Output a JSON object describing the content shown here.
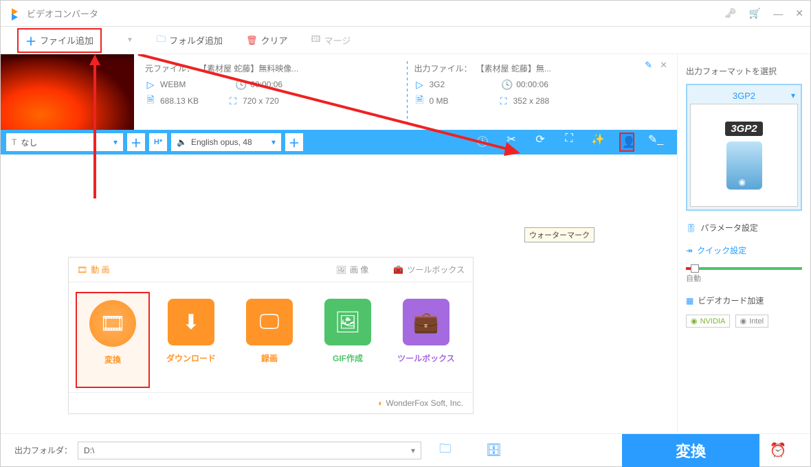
{
  "titlebar": {
    "app_name": "ビデオコンバータ"
  },
  "toolbar": {
    "add_file": "ファイル追加",
    "add_folder": "フォルダ追加",
    "clear": "クリア",
    "merge": "マージ"
  },
  "file": {
    "source_label": "元ファイル：",
    "source_name": "【素材屋 蛇藤】無料映像...",
    "src_format": "WEBM",
    "src_duration": "00:00:06",
    "src_size": "688.13 KB",
    "src_res": "720 x 720",
    "output_label": "出力ファイル：",
    "output_name": "【素材屋 蛇藤】無...",
    "out_format": "3G2",
    "out_duration": "00:00:06",
    "out_size": "0 MB",
    "out_res": "352 x 288"
  },
  "actionbar": {
    "subtitle_none": "なし",
    "audio_track": "English opus, 48"
  },
  "tooltip": {
    "watermark": "ウォーターマーク"
  },
  "category": {
    "tab_video": "動 画",
    "tab_image": "画 像",
    "tab_toolbox": "ツールボックス",
    "card_convert": "変換",
    "card_download": "ダウンロード",
    "card_record": "録画",
    "card_gif": "GIF作成",
    "card_toolbox": "ツールボックス",
    "brand": "WonderFox Soft, Inc."
  },
  "right": {
    "title": "出力フォーマットを選択",
    "format": "3GP2",
    "format_label": "3GP2",
    "param_settings": "パラメータ設定",
    "quick_settings": "クイック設定",
    "slider_label": "自動",
    "gpu_accel": "ビデオカード加速",
    "nvidia": "NVIDIA",
    "intel": "Intel"
  },
  "bottom": {
    "output_folder_label": "出力フォルダ：",
    "path": "D:\\",
    "convert": "変換"
  }
}
